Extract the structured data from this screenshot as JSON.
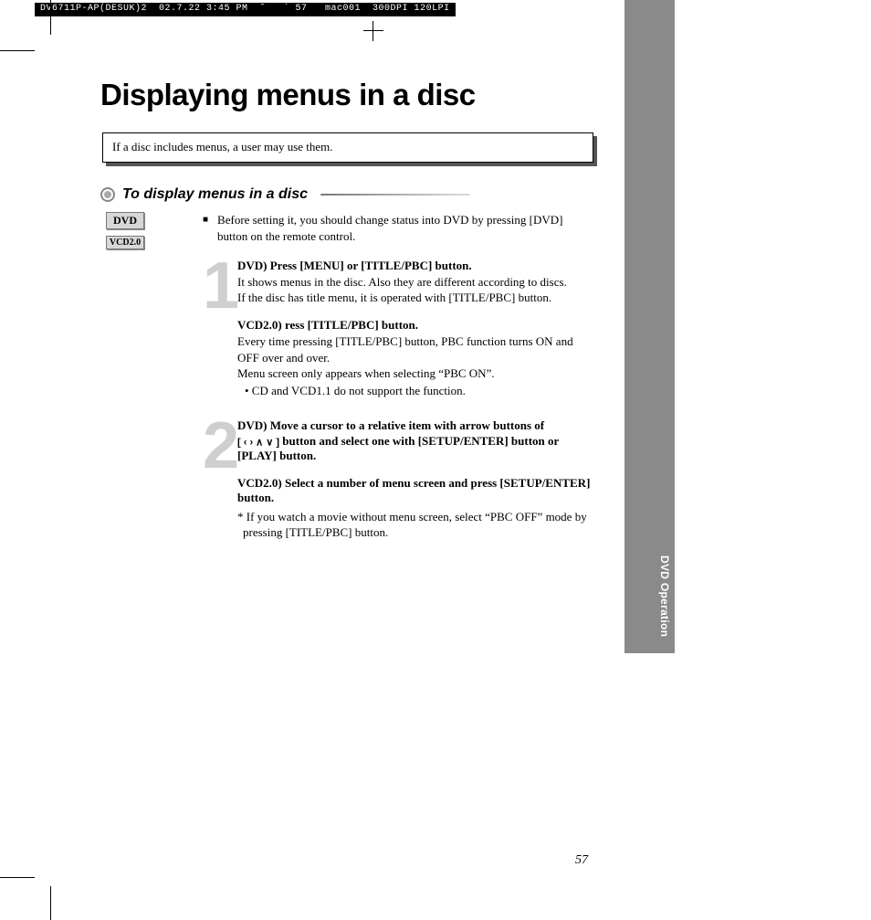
{
  "print_info": "DV6711P-AP(DESUK)2  02.7.22 3:45 PM  ˜   ` 57   mac001  300DPI 120LPI",
  "side_tab": "DVD Operation",
  "title": "Displaying menus in a disc",
  "intro": "If a disc includes menus, a user may use them.",
  "section_title": "To display menus in a disc",
  "badges": {
    "dvd": "DVD",
    "vcd": "VCD2.0"
  },
  "lead": "Before setting it, you should change status into DVD by pressing [DVD] button on the remote control.",
  "step1": {
    "a_head": "DVD) Press [MENU] or [TITLE/PBC] button.",
    "a_l1": "It shows menus in the disc. Also they are different according to discs.",
    "a_l2": "If the disc has title menu, it is operated with [TITLE/PBC] button.",
    "b_head": "VCD2.0) ress [TITLE/PBC] button.",
    "b_l1": "Every time pressing [TITLE/PBC] button, PBC function turns ON and OFF over and over.",
    "b_l2": "Menu screen only appears when selecting “PBC ON”.",
    "b_bullet": "•  CD and VCD1.1 do not support the function."
  },
  "step2": {
    "a_l1": "DVD) Move a cursor to a relative item with arrow buttons of",
    "a_arr": "[ ‹  ›  ∧  ∨ ]",
    "a_l2": " button and select one with [SETUP/ENTER] button or [PLAY] button.",
    "b_head": "VCD2.0) Select a number of menu screen and press [SETUP/ENTER] button.",
    "b_note": "* If you watch a movie without menu screen, select “PBC OFF” mode by pressing [TITLE/PBC] button."
  },
  "page_number": "57"
}
